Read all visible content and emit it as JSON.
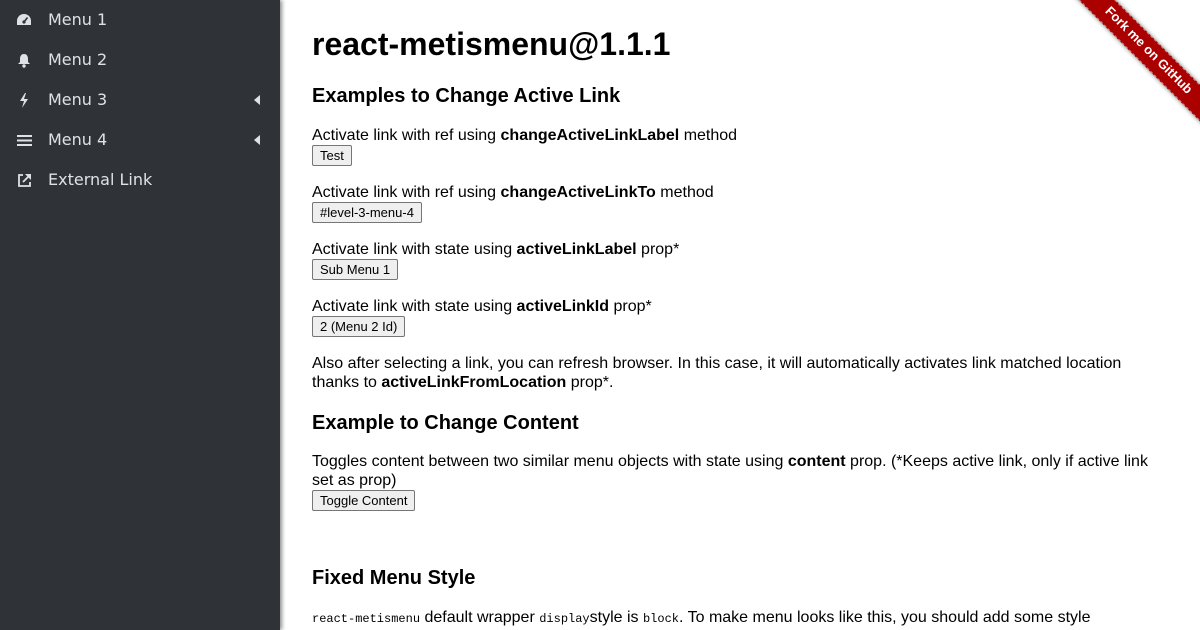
{
  "sidebar": {
    "items": [
      {
        "label": "Menu 1",
        "icon": "dashboard-icon"
      },
      {
        "label": "Menu 2",
        "icon": "bell-icon"
      },
      {
        "label": "Menu 3",
        "icon": "bolt-icon"
      },
      {
        "label": "Menu 4",
        "icon": "bars-icon"
      },
      {
        "label": "External Link",
        "icon": "external-link-icon"
      }
    ]
  },
  "main": {
    "title": "react-metismenu@1.1.1",
    "section_active": {
      "heading": "Examples to Change Active Link",
      "items": [
        {
          "prefix": "Activate link with ref using ",
          "bold": "changeActiveLinkLabel",
          "suffix": " method",
          "button": "Test"
        },
        {
          "prefix": "Activate link with ref using ",
          "bold": "changeActiveLinkTo",
          "suffix": " method",
          "button": "#level-3-menu-4"
        },
        {
          "prefix": "Activate link with state using ",
          "bold": "activeLinkLabel",
          "suffix": " prop*",
          "button": "Sub Menu 1"
        },
        {
          "prefix": "Activate link with state using ",
          "bold": "activeLinkId",
          "suffix": " prop*",
          "button": "2 (Menu 2 Id)"
        }
      ],
      "note_prefix": "Also after selecting a link, you can refresh browser. In this case, it will automatically activates link matched location thanks to ",
      "note_bold": "activeLinkFromLocation",
      "note_suffix": " prop*."
    },
    "section_content": {
      "heading": "Example to Change Content",
      "text_prefix": "Toggles content between two similar menu objects with state using ",
      "text_bold": "content",
      "text_suffix": " prop. (*Keeps active link, only if active link set as prop)",
      "button": "Toggle Content"
    },
    "section_fixed": {
      "heading": "Fixed Menu Style",
      "code1": "react-metismenu",
      "text1": " default wrapper ",
      "code2": "display",
      "text2": "style is ",
      "code3": "block",
      "text3": ". To make menu looks like this, you should add some style"
    }
  },
  "ribbon": {
    "label": "Fork me on GitHub",
    "color": "#aa0000"
  },
  "colors": {
    "sidebar_bg": "#2f3338",
    "sidebar_text": "#dfe2e5"
  }
}
